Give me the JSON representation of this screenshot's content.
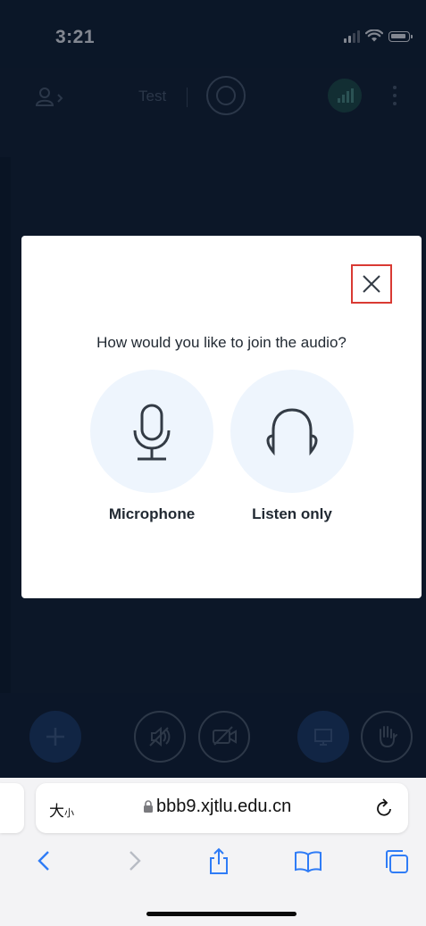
{
  "status_bar": {
    "time": "3:21"
  },
  "meeting": {
    "title": "Test"
  },
  "dialog": {
    "question": "How would you like to join the audio?",
    "options": [
      {
        "label": "Microphone",
        "icon": "microphone-icon"
      },
      {
        "label": "Listen only",
        "icon": "headphones-icon"
      }
    ],
    "close_icon": "close-icon"
  },
  "browser": {
    "text_size_label": "大",
    "text_size_small": "小",
    "url": "bbb9.xjtlu.edu.cn"
  },
  "colors": {
    "background": "#0c1a2c",
    "modal": "#ffffff",
    "option_circle": "#eef5fd",
    "close_highlight": "#d93a33",
    "browser_accent": "#2f7cf6"
  }
}
